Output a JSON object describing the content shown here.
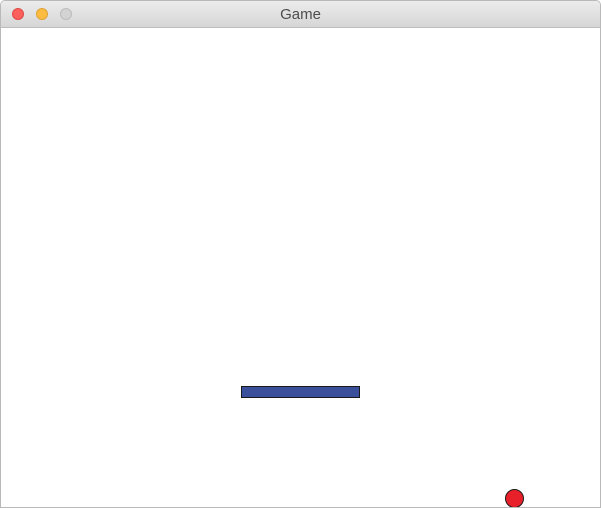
{
  "window": {
    "title": "Game"
  },
  "colors": {
    "paddle": "#3b509b",
    "ball": "#e8202a",
    "background": "#ffffff"
  },
  "icons": {
    "close": "close-icon",
    "minimize": "minimize-icon",
    "zoom": "zoom-icon"
  }
}
